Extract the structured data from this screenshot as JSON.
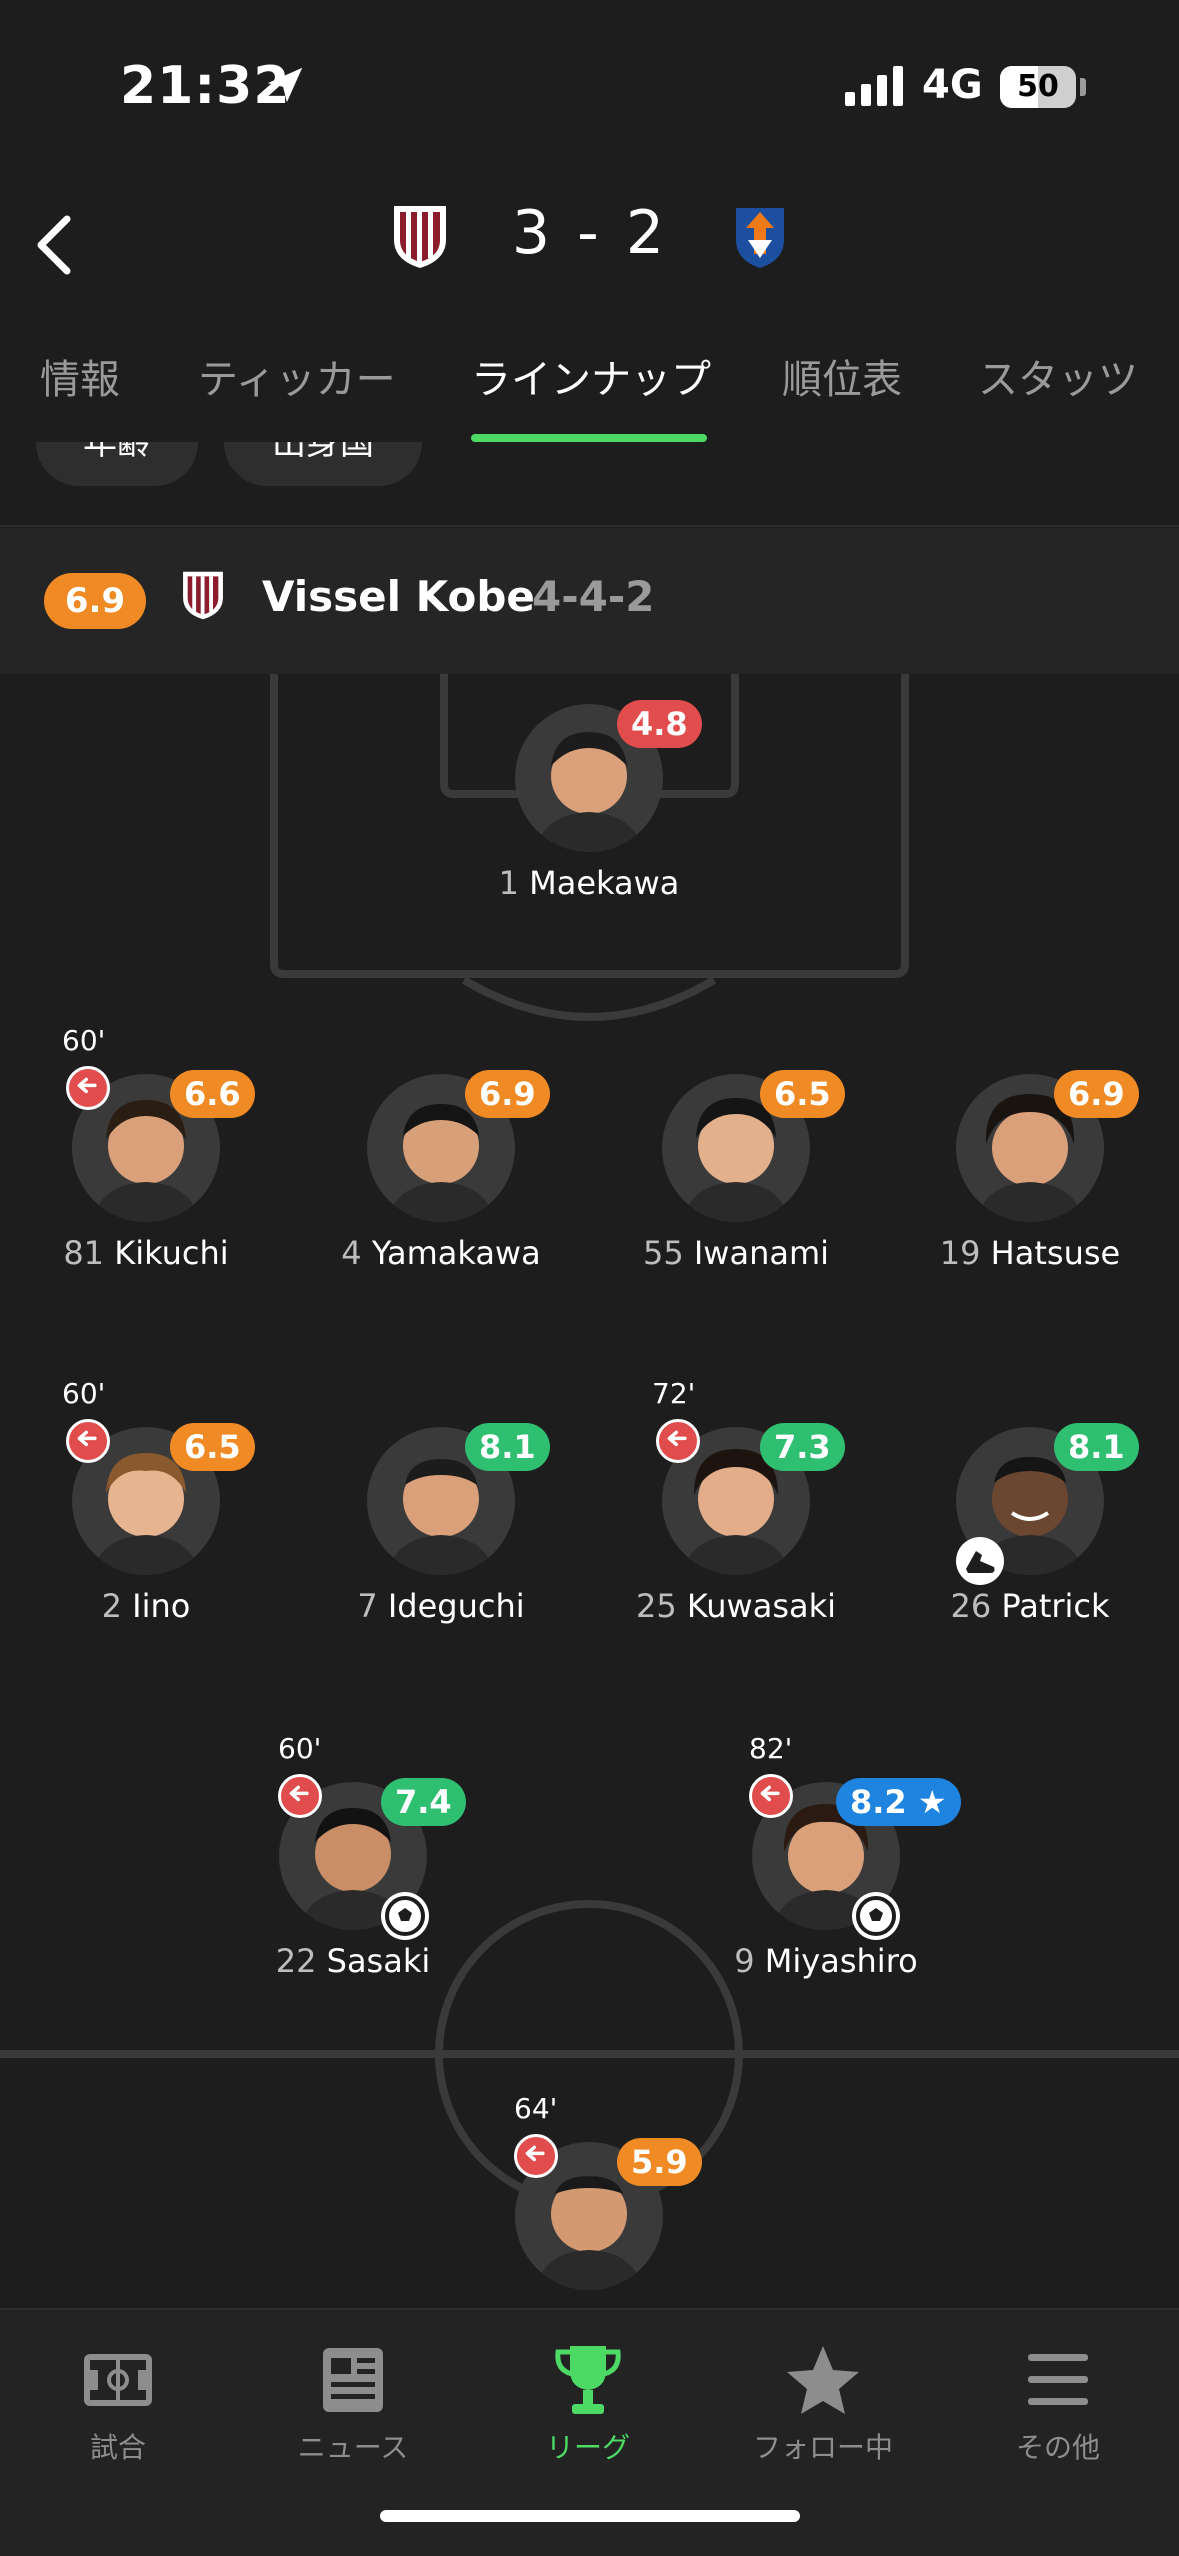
{
  "status": {
    "time": "21:32",
    "network": "4G",
    "battery": "50"
  },
  "header": {
    "score": "3 - 2"
  },
  "tabs": [
    {
      "label": "情報"
    },
    {
      "label": "ティッカー"
    },
    {
      "label": "ラインナップ"
    },
    {
      "label": "順位表"
    },
    {
      "label": "スタッツ"
    }
  ],
  "chips": [
    {
      "label": "年齢"
    },
    {
      "label": "出身国"
    }
  ],
  "team": {
    "rating": "6.9",
    "name": "Vissel Kobe",
    "formation": "4-4-2"
  },
  "players": [
    {
      "num": "1",
      "name": "Maekawa",
      "rating": "4.8",
      "rating_color": "red"
    },
    {
      "num": "81",
      "name": "Kikuchi",
      "rating": "6.6",
      "rating_color": "orange",
      "sub": "60'"
    },
    {
      "num": "4",
      "name": "Yamakawa",
      "rating": "6.9",
      "rating_color": "orange"
    },
    {
      "num": "55",
      "name": "Iwanami",
      "rating": "6.5",
      "rating_color": "orange"
    },
    {
      "num": "19",
      "name": "Hatsuse",
      "rating": "6.9",
      "rating_color": "orange"
    },
    {
      "num": "2",
      "name": "Iino",
      "rating": "6.5",
      "rating_color": "orange",
      "sub": "60'"
    },
    {
      "num": "7",
      "name": "Ideguchi",
      "rating": "8.1",
      "rating_color": "green"
    },
    {
      "num": "25",
      "name": "Kuwasaki",
      "rating": "7.3",
      "rating_color": "green",
      "sub": "72'"
    },
    {
      "num": "26",
      "name": "Patrick",
      "rating": "8.1",
      "rating_color": "green",
      "event": "boot-icon"
    },
    {
      "num": "22",
      "name": "Sasaki",
      "rating": "7.4",
      "rating_color": "green",
      "sub": "60'",
      "event": "goal-ball-icon"
    },
    {
      "num": "9",
      "name": "Miyashiro",
      "rating": "8.2 ★",
      "rating_color": "blue",
      "sub": "82'",
      "event": "goal-ball-icon"
    },
    {
      "num": "",
      "name": "",
      "rating": "5.9",
      "rating_color": "orange",
      "sub": "64'"
    }
  ],
  "nav": [
    {
      "label": "試合",
      "icon": "pitch-icon"
    },
    {
      "label": "ニュース",
      "icon": "news-icon"
    },
    {
      "label": "リーグ",
      "icon": "trophy-icon"
    },
    {
      "label": "フォロー中",
      "icon": "star-icon"
    },
    {
      "label": "その他",
      "icon": "menu-icon"
    }
  ],
  "colors": {
    "accent": "#4cd964",
    "orange": "#f08a24",
    "green": "#2fbf71",
    "red": "#e14c4c",
    "blue": "#1f84e0"
  }
}
